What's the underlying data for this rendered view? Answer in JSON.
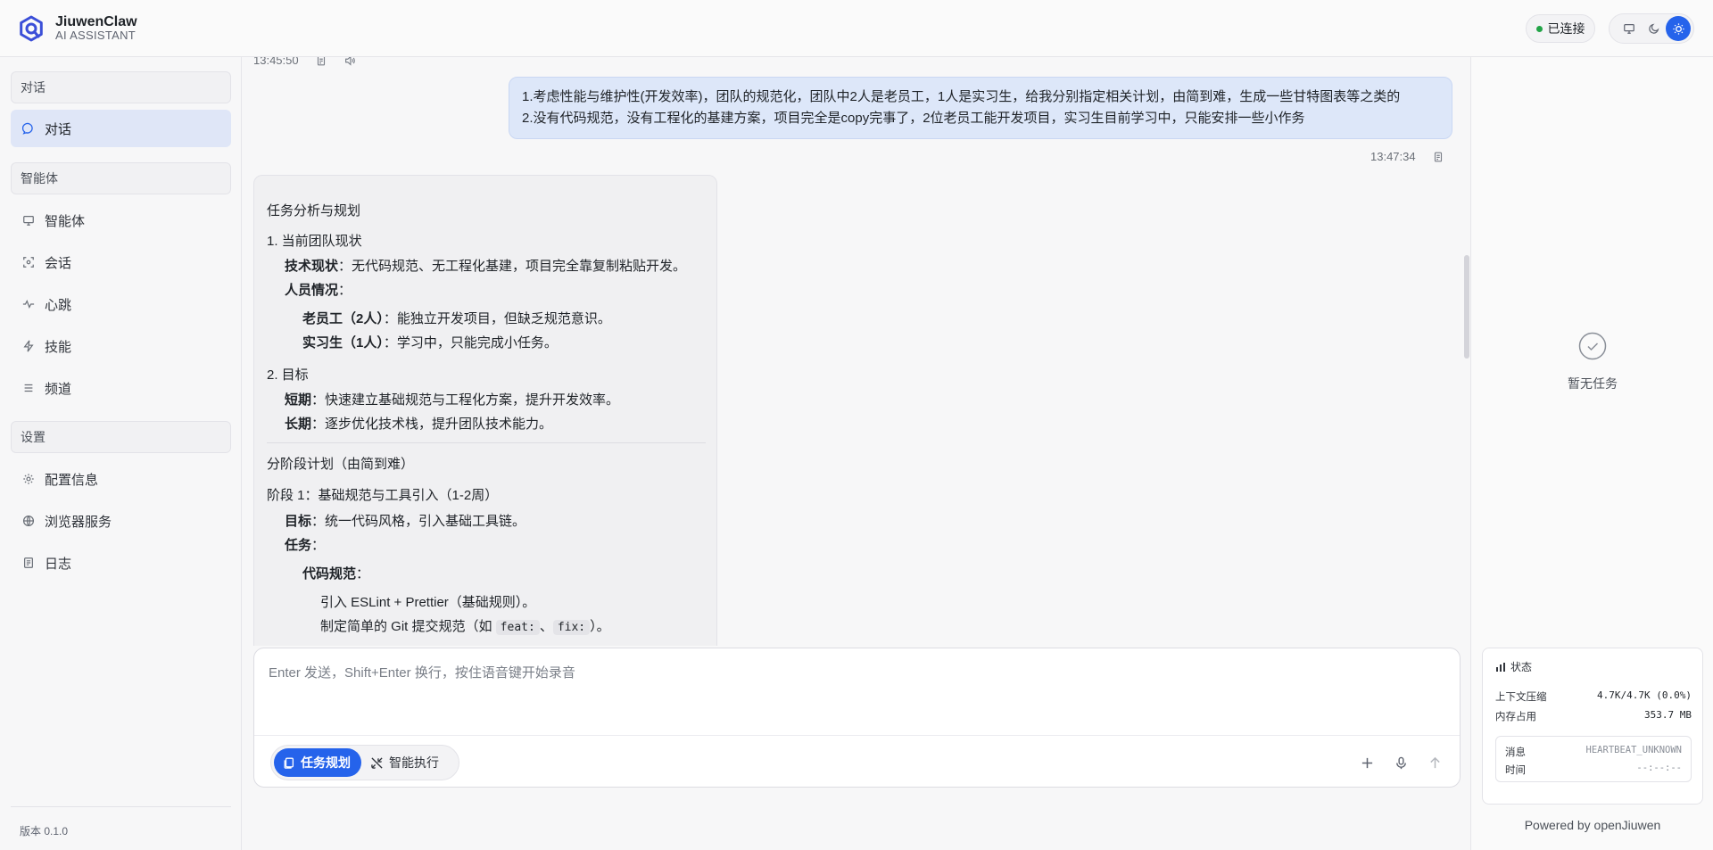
{
  "header": {
    "brand_name": "JiuwenClaw",
    "brand_sub": "AI ASSISTANT",
    "connection_status": "已连接"
  },
  "sidebar": {
    "sections": [
      {
        "title": "对话"
      },
      {
        "title": "智能体"
      },
      {
        "title": "设置"
      }
    ],
    "items": [
      {
        "label": "对话",
        "icon": "chat-bubble-icon",
        "active": true
      },
      {
        "label": "智能体",
        "icon": "monitor-icon"
      },
      {
        "label": "会话",
        "icon": "scan-icon"
      },
      {
        "label": "心跳",
        "icon": "pulse-icon"
      },
      {
        "label": "技能",
        "icon": "bolt-icon"
      },
      {
        "label": "频道",
        "icon": "list-icon"
      },
      {
        "label": "配置信息",
        "icon": "gear-icon"
      },
      {
        "label": "浏览器服务",
        "icon": "globe-icon"
      },
      {
        "label": "日志",
        "icon": "document-icon"
      }
    ],
    "version": "版本 0.1.0"
  },
  "chat": {
    "prev_timestamp": "13:45:50",
    "user_message": {
      "line1": "1.考虑性能与维护性(开发效率)，团队的规范化，团队中2人是老员工，1人是实习生，给我分别指定相关计划，由简到难，生成一些甘特图表等之类的",
      "line2": "2.没有代码规范，没有工程化的基建方案，项目完全是copy完事了，2位老员工能开发项目，实习生目前学习中，只能安排一些小作务",
      "timestamp": "13:47:34"
    },
    "ai_response": {
      "title": "任务分析与规划",
      "s1_heading": "1. 当前团队现状",
      "tech_label": "技术现状",
      "tech_text": "：无代码规范、无工程化基建，项目完全靠复制粘贴开发。",
      "people_label": "人员情况",
      "people_text": "：",
      "senior_label": "老员工（2人）",
      "senior_text": "：能独立开发项目，但缺乏规范意识。",
      "intern_label": "实习生（1人）",
      "intern_text": "：学习中，只能完成小任务。",
      "s2_heading": "2. 目标",
      "short_label": "短期",
      "short_text": "：快速建立基础规范与工程化方案，提升开发效率。",
      "long_label": "长期",
      "long_text": "：逐步优化技术栈，提升团队技术能力。",
      "plan_title": "分阶段计划（由简到难）",
      "stage1_heading": "阶段 1：基础规范与工具引入（1-2周）",
      "goal_label": "目标",
      "goal_text": "：统一代码风格，引入基础工具链。",
      "task_label": "任务",
      "task_text": "：",
      "code_label": "代码规范",
      "code_text": "：",
      "eslint_text": "引入 ESLint + Prettier（基础规则）。",
      "git_prefix": "制定简单的 Git 提交规范（如 ",
      "git_code1": "feat:",
      "git_sep": "、",
      "git_code2": "fix:",
      "git_suffix": "）。"
    }
  },
  "composer": {
    "placeholder": "Enter 发送，Shift+Enter 换行，按住语音键开始录音",
    "value": "",
    "mode_plan": "任务规划",
    "mode_exec": "智能执行"
  },
  "right_panel": {
    "empty_text": "暂无任务",
    "status_title": "状态",
    "context_label": "上下文压缩",
    "context_value": "4.7K/4.7K (0.0%)",
    "memory_label": "内存占用",
    "memory_value": "353.7 MB",
    "heartbeat_msg_label": "消息",
    "heartbeat_msg_value": "HEARTBEAT_UNKNOWN",
    "heartbeat_time_label": "时间",
    "heartbeat_time_value": "--:--:--",
    "powered": "Powered by openJiuwen"
  },
  "colors": {
    "accent": "#2563eb",
    "connected": "#22a447",
    "user_bubble": "#dde7f9"
  }
}
